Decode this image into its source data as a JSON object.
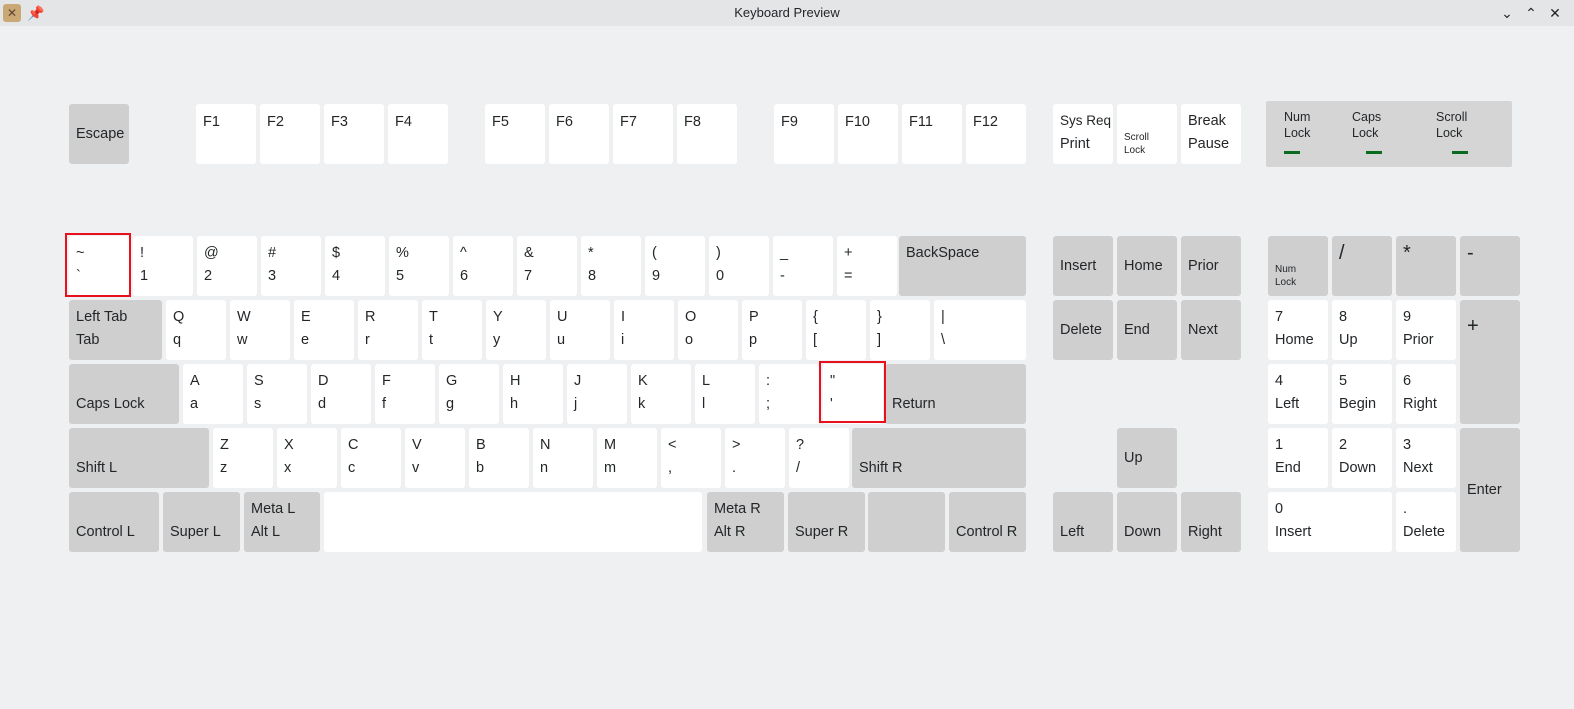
{
  "window": {
    "title": "Keyboard Preview",
    "app_icon": "keyboard-app-icon",
    "pin_icon": "pin-icon",
    "buttons": {
      "minimize": "minimize-icon",
      "maximize": "maximize-icon",
      "close": "close-icon"
    }
  },
  "leds": [
    {
      "top": "Num",
      "bottom": "Lock",
      "on_color": "#0b6b1d"
    },
    {
      "top": "Caps",
      "bottom": "Lock",
      "on_color": "#0b6b1d"
    },
    {
      "top": "Scroll",
      "bottom": "Lock",
      "on_color": "#0b6b1d"
    }
  ],
  "colors": {
    "key_white": "#ffffff",
    "key_gray": "#cfcfcf",
    "highlight": "#e8101c",
    "background": "#eff0f1"
  },
  "keys": {
    "escape": "Escape",
    "f1": "F1",
    "f2": "F2",
    "f3": "F3",
    "f4": "F4",
    "f5": "F5",
    "f6": "F6",
    "f7": "F7",
    "f8": "F8",
    "f9": "F9",
    "f10": "F10",
    "f11": "F11",
    "f12": "F12",
    "sysreq": {
      "top": "Sys Req",
      "bottom": "Print"
    },
    "scroll_lock": {
      "top": "Scroll",
      "bottom": "Lock"
    },
    "break": {
      "top": "Break",
      "bottom": "Pause"
    },
    "grave": {
      "top": "~",
      "bottom": "`"
    },
    "n1": {
      "top": "!",
      "bottom": "1"
    },
    "n2": {
      "top": "@",
      "bottom": "2"
    },
    "n3": {
      "top": "#",
      "bottom": "3"
    },
    "n4": {
      "top": "$",
      "bottom": "4"
    },
    "n5": {
      "top": "%",
      "bottom": "5"
    },
    "n6": {
      "top": "^",
      "bottom": "6"
    },
    "n7": {
      "top": "&",
      "bottom": "7"
    },
    "n8": {
      "top": "*",
      "bottom": "8"
    },
    "n9": {
      "top": "(",
      "bottom": "9"
    },
    "n0": {
      "top": ")",
      "bottom": "0"
    },
    "minus": {
      "top": "_",
      "bottom": "-"
    },
    "equal": {
      "top": "+",
      "bottom": "="
    },
    "backspace": "BackSpace",
    "tab": {
      "top": "Left Tab",
      "bottom": "Tab"
    },
    "q": {
      "top": "Q",
      "bottom": "q"
    },
    "w": {
      "top": "W",
      "bottom": "w"
    },
    "e": {
      "top": "E",
      "bottom": "e"
    },
    "r": {
      "top": "R",
      "bottom": "r"
    },
    "t": {
      "top": "T",
      "bottom": "t"
    },
    "y": {
      "top": "Y",
      "bottom": "y"
    },
    "u": {
      "top": "U",
      "bottom": "u"
    },
    "i": {
      "top": "I",
      "bottom": "i"
    },
    "o": {
      "top": "O",
      "bottom": "o"
    },
    "p": {
      "top": "P",
      "bottom": "p"
    },
    "lbracket": {
      "top": "{",
      "bottom": "["
    },
    "rbracket": {
      "top": "}",
      "bottom": "]"
    },
    "backslash": {
      "top": "|",
      "bottom": "\\"
    },
    "caps": "Caps Lock",
    "a": {
      "top": "A",
      "bottom": "a"
    },
    "s": {
      "top": "S",
      "bottom": "s"
    },
    "d": {
      "top": "D",
      "bottom": "d"
    },
    "f": {
      "top": "F",
      "bottom": "f"
    },
    "g": {
      "top": "G",
      "bottom": "g"
    },
    "h": {
      "top": "H",
      "bottom": "h"
    },
    "j": {
      "top": "J",
      "bottom": "j"
    },
    "k": {
      "top": "K",
      "bottom": "k"
    },
    "l": {
      "top": "L",
      "bottom": "l"
    },
    "semicolon": {
      "top": ":",
      "bottom": ";"
    },
    "quote": {
      "top": "\"",
      "bottom": "'"
    },
    "return": "Return",
    "shift_l": "Shift L",
    "z": {
      "top": "Z",
      "bottom": "z"
    },
    "x": {
      "top": "X",
      "bottom": "x"
    },
    "c": {
      "top": "C",
      "bottom": "c"
    },
    "v": {
      "top": "V",
      "bottom": "v"
    },
    "b": {
      "top": "B",
      "bottom": "b"
    },
    "n": {
      "top": "N",
      "bottom": "n"
    },
    "m": {
      "top": "M",
      "bottom": "m"
    },
    "comma": {
      "top": "<",
      "bottom": ","
    },
    "period": {
      "top": ">",
      "bottom": "."
    },
    "slash": {
      "top": "?",
      "bottom": "/"
    },
    "shift_r": "Shift R",
    "control_l": "Control L",
    "super_l": "Super L",
    "meta_l": {
      "top": "Meta L",
      "bottom": "Alt L"
    },
    "space": "",
    "meta_r": {
      "top": "Meta R",
      "bottom": "Alt R"
    },
    "super_r": "Super R",
    "menu": "",
    "control_r": "Control R",
    "insert": "Insert",
    "home": "Home",
    "prior": "Prior",
    "delete": "Delete",
    "end": "End",
    "next": "Next",
    "up": "Up",
    "left": "Left",
    "down": "Down",
    "right": "Right",
    "kp_numlock": {
      "top": "Num",
      "bottom": "Lock"
    },
    "kp_divide": "/",
    "kp_multiply": "*",
    "kp_minus": "-",
    "kp_plus": "+",
    "kp_7": {
      "top": "7",
      "bottom": "Home"
    },
    "kp_8": {
      "top": "8",
      "bottom": "Up"
    },
    "kp_9": {
      "top": "9",
      "bottom": "Prior"
    },
    "kp_4": {
      "top": "4",
      "bottom": "Left"
    },
    "kp_5": {
      "top": "5",
      "bottom": "Begin"
    },
    "kp_6": {
      "top": "6",
      "bottom": "Right"
    },
    "kp_1": {
      "top": "1",
      "bottom": "End"
    },
    "kp_2": {
      "top": "2",
      "bottom": "Down"
    },
    "kp_3": {
      "top": "3",
      "bottom": "Next"
    },
    "kp_0": {
      "top": "0",
      "bottom": "Insert"
    },
    "kp_dot": {
      "top": ".",
      "bottom": "Delete"
    },
    "kp_enter": "Enter"
  }
}
